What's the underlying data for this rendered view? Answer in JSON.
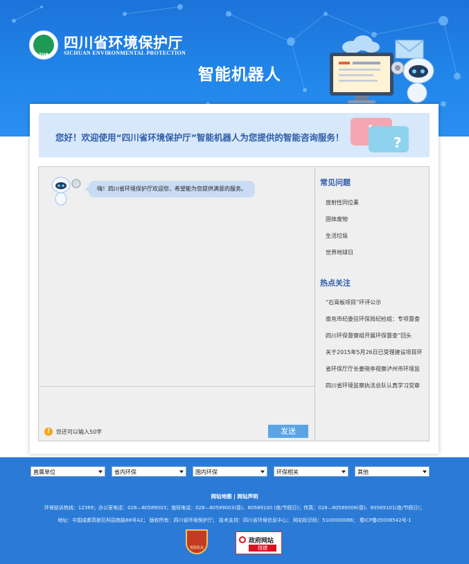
{
  "header": {
    "org_name": "四川省环境保护厅",
    "org_name_en": "SICHUAN ENVIRONMENTAL PROTECTION",
    "logo_text": "ZHB",
    "product_title": "智能机器人"
  },
  "welcome": {
    "text": "您好！欢迎使用“四川省环境保护厅”智能机器人为您提供的智能咨询服务！",
    "bubble_mark_1": "!",
    "bubble_mark_2": "?"
  },
  "chat": {
    "bot_message": "嗨！四川省环境保护厅欢迎您，希望能为您提供满意的服务。",
    "input_limit_text": "您还可以输入50字",
    "send_label": "发送"
  },
  "faq": {
    "heading": "常见问题",
    "items": [
      "放射性同位素",
      "固体废物",
      "生活垃圾",
      "世界地球日"
    ]
  },
  "hot": {
    "heading": "热点关注",
    "items": [
      "“石膏板项目”环评公示",
      "南充市纪委驻环保局纪检组：专项督查",
      "四川环保督察组开展环保督查“回头",
      "关于2015年5月26日已受理建设项目环",
      "省环保厅厅长姜晓亭视察泸州市环境监",
      "四川省环境监察执法总队认真学习党章"
    ]
  },
  "footer": {
    "selects": [
      "直属单位",
      "省内环保",
      "国内环保",
      "环保相关",
      "其他"
    ],
    "link_sitemap": "网站地图",
    "link_separator": "|",
    "link_statement": "网站声明",
    "contact_line": "环保投诉热线：12369；办公室电话：028—80589003；值班电话：028—80589003(昼)、80589100 (夜/节假日)；传真：028—80589008(昼)、80589101(夜/节假日)；",
    "address_line": "地址：中国成都高新区科园南路88号A2；  版权所有：四川省环境保护厅；  技术支持：四川省环境信息中心；  网站标识码：5100000086；  蜀ICP备05008542号-1",
    "badge_party": "党政机关",
    "badge_gov_title": "政府网站",
    "badge_gov_sub": "找错"
  },
  "colors": {
    "banner": "#2287ea",
    "accent_text": "#2e5da8",
    "footer": "#2b7bd6",
    "send_button": "#5aa4e6"
  }
}
